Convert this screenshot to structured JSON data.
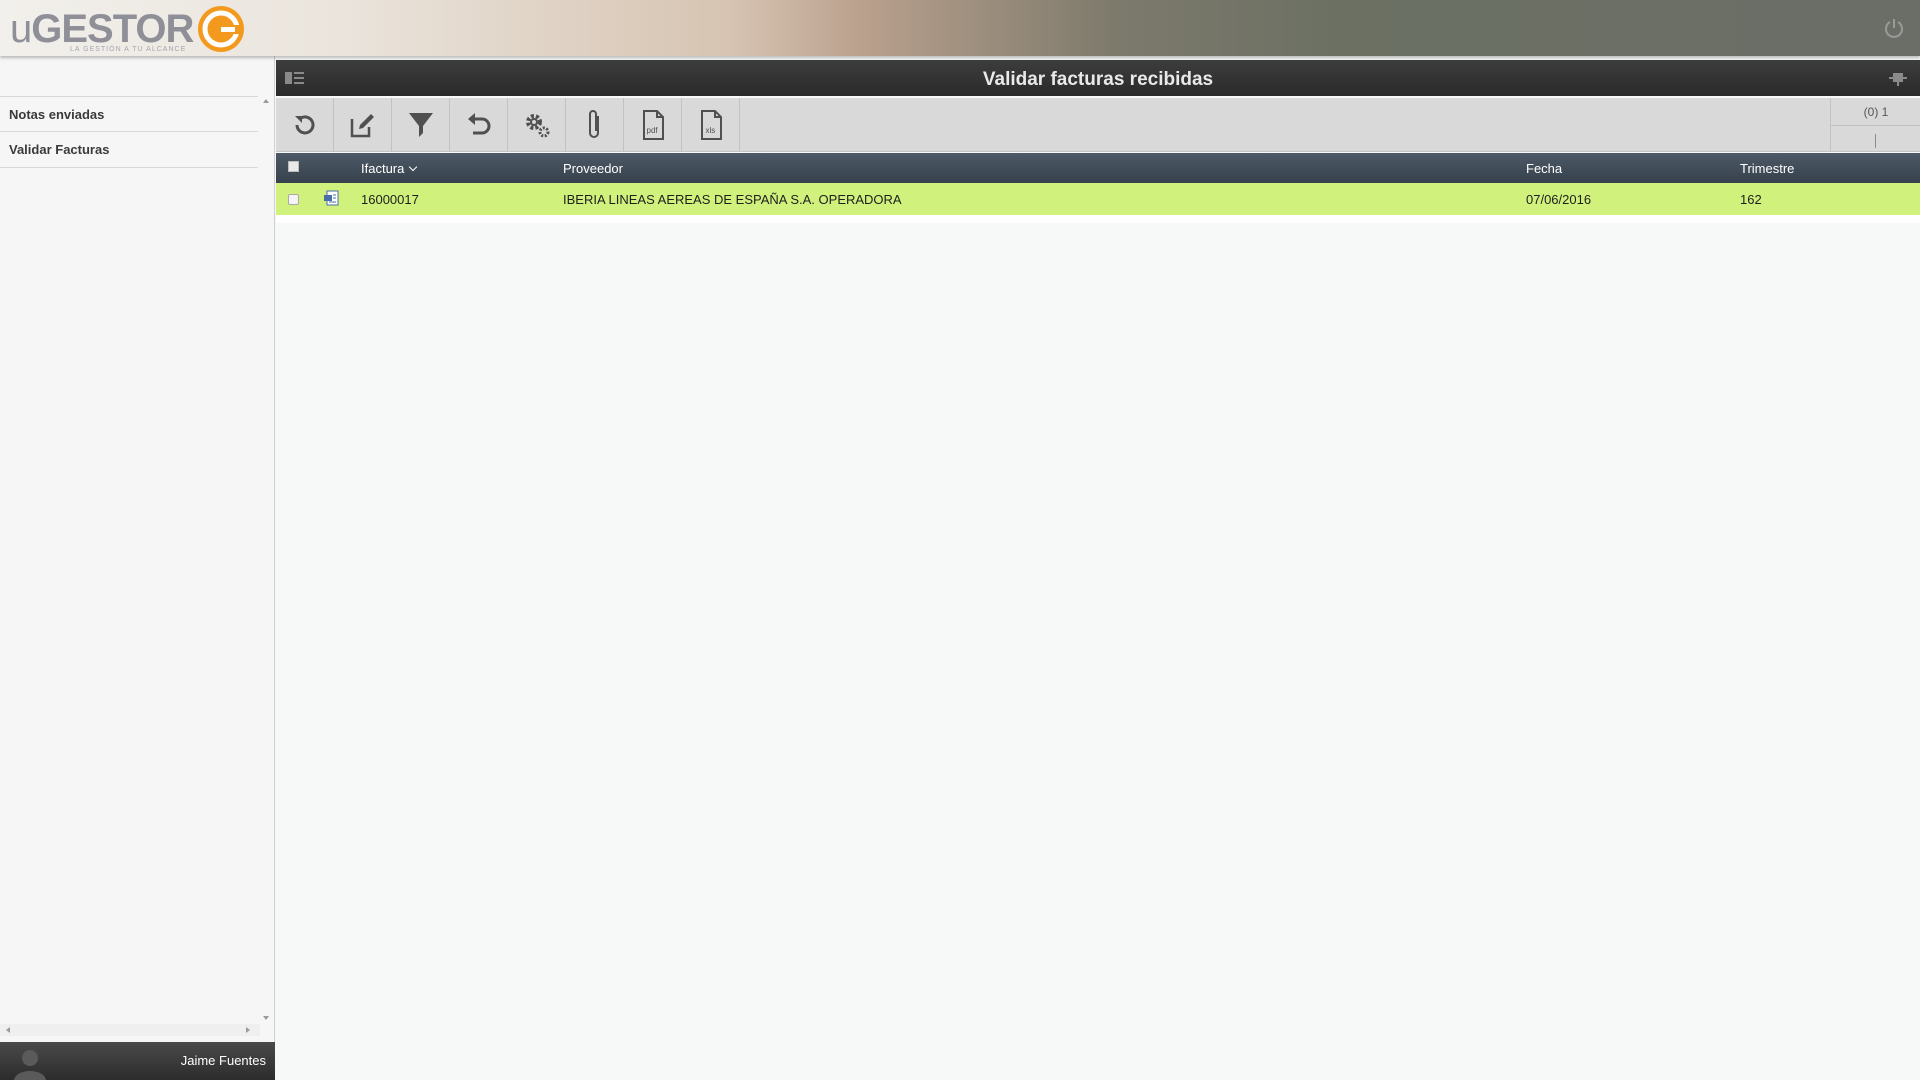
{
  "app": {
    "logo_u": "u",
    "logo_name": "GESTOR",
    "logo_tagline": "LA GESTIÓN A TU ALCANCE",
    "icons": {
      "logo": "ugestor-g-logo-icon",
      "power": "power-icon"
    },
    "colors": {
      "logo_orange": "#f39a1e",
      "logo_gray": "#8f8f98"
    }
  },
  "sidebar": {
    "items": [
      {
        "label": "Notas enviadas"
      },
      {
        "label": "Validar Facturas"
      }
    ],
    "user": {
      "name": "Jaime Fuentes",
      "avatar_icon": "user-silhouette-icon"
    }
  },
  "main": {
    "title": "Validar facturas recibidas",
    "icons": {
      "panel_toggle": "panel-toggle-icon",
      "pin": "pin-icon"
    },
    "toolbar": [
      {
        "name": "refresh-icon"
      },
      {
        "name": "edit-icon"
      },
      {
        "name": "filter-icon"
      },
      {
        "name": "undo-icon"
      },
      {
        "name": "settings-icon"
      },
      {
        "name": "attachment-icon"
      },
      {
        "name": "pdf-export-icon",
        "label": "pdf"
      },
      {
        "name": "xls-export-icon",
        "label": "xls"
      }
    ],
    "pager": {
      "text": "(0) 1"
    },
    "table": {
      "columns": [
        "Ifactura",
        "Proveedor",
        "Fecha",
        "Trimestre"
      ],
      "sorted_column": "Ifactura",
      "rows": [
        {
          "ifactura": "16000017",
          "proveedor": "IBERIA LINEAS AEREAS DE ESPAÑA S.A. OPERADORA",
          "fecha": "07/06/2016",
          "trimestre": "162",
          "icon": "document-icon"
        }
      ]
    },
    "colors": {
      "selected_row": "#d0f27c",
      "header_bg": "#3d4753",
      "title_bg": "#333333"
    }
  }
}
